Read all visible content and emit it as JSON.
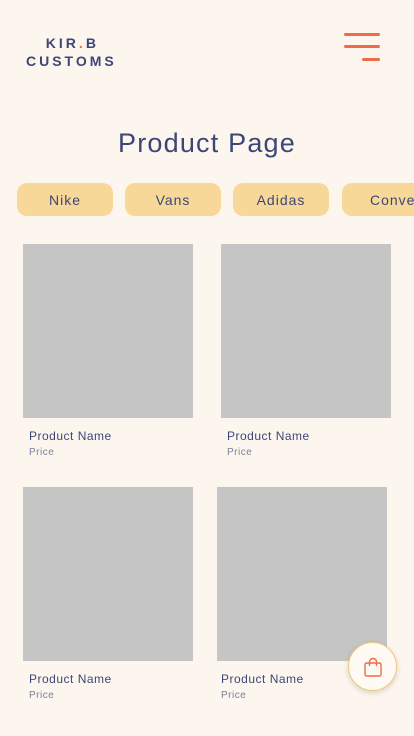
{
  "header": {
    "logo_line1_part1": "KIR",
    "logo_dot": ".",
    "logo_line1_part2": "B",
    "logo_line2": "CUSTOMS",
    "menu_icon": "hamburger-menu-icon"
  },
  "title": "Product Page",
  "filters": [
    "Nike",
    "Vans",
    "Adidas",
    "Conve"
  ],
  "products": [
    {
      "name": "Product Name",
      "price": "Price"
    },
    {
      "name": "Product Name",
      "price": "Price"
    },
    {
      "name": "Product Name",
      "price": "Price"
    },
    {
      "name": "Product Name",
      "price": "Price"
    }
  ],
  "cart": {
    "icon": "shopping-bag-icon"
  },
  "colors": {
    "background": "#fdf6ef",
    "primary_text": "#3d4678",
    "accent": "#ef6b4a",
    "chip": "#f7d898",
    "placeholder": "#c5c5c5"
  }
}
